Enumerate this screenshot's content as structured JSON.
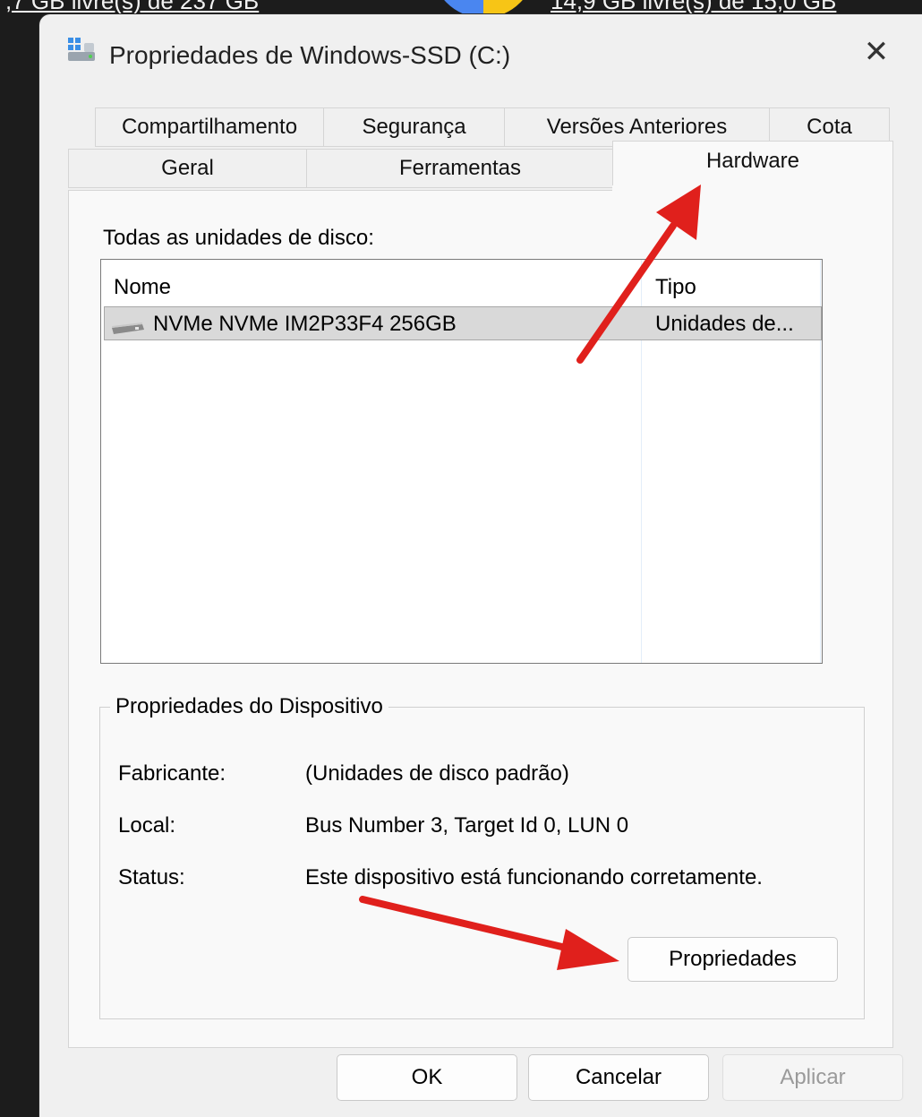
{
  "background": {
    "left_text": ",7 GB livre(s) de 237 GB",
    "right_text": "14,9 GB livre(s) de 15,0 GB"
  },
  "dialog": {
    "title": "Propriedades de Windows-SSD (C:)",
    "close_glyph": "✕"
  },
  "tabs": {
    "row1": [
      "Compartilhamento",
      "Segurança",
      "Versões Anteriores",
      "Cota"
    ],
    "row2": [
      "Geral",
      "Ferramentas",
      "Hardware"
    ],
    "active": "Hardware"
  },
  "hardware": {
    "disks_label": "Todas as unidades de disco:",
    "columns": [
      "Nome",
      "Tipo"
    ],
    "rows": [
      {
        "name": "NVMe NVMe IM2P33F4 256GB",
        "type": "Unidades de..."
      }
    ]
  },
  "device_properties": {
    "title": "Propriedades do Dispositivo",
    "items": [
      {
        "label": "Fabricante:",
        "value": "(Unidades de disco padrão)"
      },
      {
        "label": "Local:",
        "value": "Bus Number 3, Target Id 0, LUN 0"
      },
      {
        "label": "Status:",
        "value": "Este dispositivo está funcionando corretamente."
      }
    ],
    "button_label": "Propriedades"
  },
  "buttons": {
    "ok": "OK",
    "cancel": "Cancelar",
    "apply": "Aplicar"
  },
  "colors": {
    "annotation_arrow": "#e0201c",
    "dialog_bg": "#f0f0f0",
    "selected_row": "#d9d9d9"
  },
  "icons": {
    "title": "drive-icon",
    "row": "hard-disk-icon",
    "close": "close-icon"
  }
}
